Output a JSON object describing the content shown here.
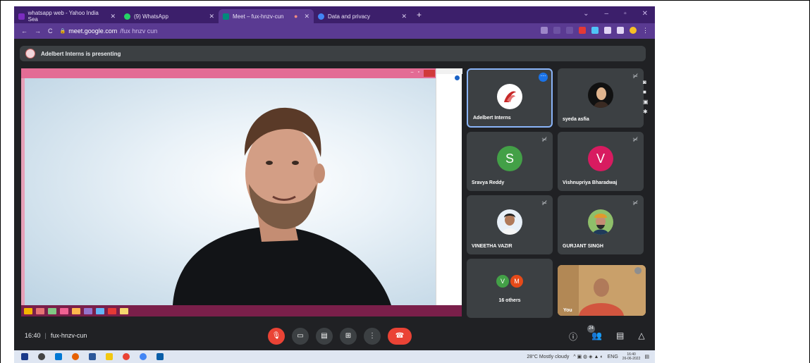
{
  "browser": {
    "tabs": [
      {
        "label": "whatsapp web - Yahoo India Sea",
        "icon": "yahoo-icon",
        "color": "#7b2cbf"
      },
      {
        "label": "(9) WhatsApp",
        "icon": "whatsapp-icon",
        "color": "#25d366"
      },
      {
        "label": "Meet – fux-hnzv-cun",
        "icon": "meet-icon",
        "color": "#00897b",
        "active": true
      },
      {
        "label": "Data and privacy",
        "icon": "google-icon",
        "color": "#4285f4"
      }
    ],
    "url_host": "meet.google.com",
    "url_path": "/fux hnzv cun"
  },
  "presenting": {
    "text": "Adelbert Interns is presenting"
  },
  "participants": [
    {
      "name": "Adelbert Interns",
      "kind": "logo",
      "selected": true
    },
    {
      "name": "syeda asfia",
      "kind": "photo"
    },
    {
      "name": "Sravya Reddy",
      "kind": "initial",
      "initial": "S",
      "color": "#43a047"
    },
    {
      "name": "Vishnupriya Bharadwaj",
      "kind": "initial",
      "initial": "V",
      "color": "#d81b60"
    },
    {
      "name": "VINEETHA VAZIR",
      "kind": "photo"
    },
    {
      "name": "GURJANT SINGH",
      "kind": "photo"
    }
  ],
  "others": {
    "label": "16 others",
    "minis": [
      {
        "initial": "V",
        "color": "#43a047"
      },
      {
        "initial": "M",
        "color": "#e64a19"
      }
    ]
  },
  "self": {
    "label": "You"
  },
  "bottom": {
    "time": "16:40",
    "code": "fux-hnzv-cun",
    "people_count": "24"
  },
  "taskbar": {
    "weather": "28°C Mostly cloudy",
    "lang": "ENG",
    "time": "16:40",
    "date": "26-06-2022"
  }
}
